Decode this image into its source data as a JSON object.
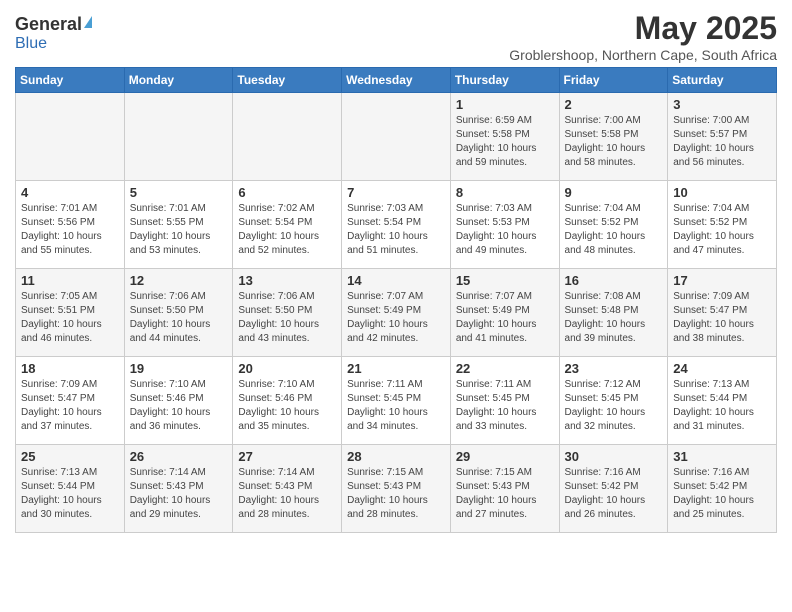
{
  "header": {
    "logo": {
      "general": "General",
      "blue": "Blue"
    },
    "title": "May 2025",
    "subtitle": "Groblershoop, Northern Cape, South Africa"
  },
  "weekdays": [
    "Sunday",
    "Monday",
    "Tuesday",
    "Wednesday",
    "Thursday",
    "Friday",
    "Saturday"
  ],
  "weeks": [
    [
      {
        "day": "",
        "info": ""
      },
      {
        "day": "",
        "info": ""
      },
      {
        "day": "",
        "info": ""
      },
      {
        "day": "",
        "info": ""
      },
      {
        "day": "1",
        "info": "Sunrise: 6:59 AM\nSunset: 5:58 PM\nDaylight: 10 hours\nand 59 minutes."
      },
      {
        "day": "2",
        "info": "Sunrise: 7:00 AM\nSunset: 5:58 PM\nDaylight: 10 hours\nand 58 minutes."
      },
      {
        "day": "3",
        "info": "Sunrise: 7:00 AM\nSunset: 5:57 PM\nDaylight: 10 hours\nand 56 minutes."
      }
    ],
    [
      {
        "day": "4",
        "info": "Sunrise: 7:01 AM\nSunset: 5:56 PM\nDaylight: 10 hours\nand 55 minutes."
      },
      {
        "day": "5",
        "info": "Sunrise: 7:01 AM\nSunset: 5:55 PM\nDaylight: 10 hours\nand 53 minutes."
      },
      {
        "day": "6",
        "info": "Sunrise: 7:02 AM\nSunset: 5:54 PM\nDaylight: 10 hours\nand 52 minutes."
      },
      {
        "day": "7",
        "info": "Sunrise: 7:03 AM\nSunset: 5:54 PM\nDaylight: 10 hours\nand 51 minutes."
      },
      {
        "day": "8",
        "info": "Sunrise: 7:03 AM\nSunset: 5:53 PM\nDaylight: 10 hours\nand 49 minutes."
      },
      {
        "day": "9",
        "info": "Sunrise: 7:04 AM\nSunset: 5:52 PM\nDaylight: 10 hours\nand 48 minutes."
      },
      {
        "day": "10",
        "info": "Sunrise: 7:04 AM\nSunset: 5:52 PM\nDaylight: 10 hours\nand 47 minutes."
      }
    ],
    [
      {
        "day": "11",
        "info": "Sunrise: 7:05 AM\nSunset: 5:51 PM\nDaylight: 10 hours\nand 46 minutes."
      },
      {
        "day": "12",
        "info": "Sunrise: 7:06 AM\nSunset: 5:50 PM\nDaylight: 10 hours\nand 44 minutes."
      },
      {
        "day": "13",
        "info": "Sunrise: 7:06 AM\nSunset: 5:50 PM\nDaylight: 10 hours\nand 43 minutes."
      },
      {
        "day": "14",
        "info": "Sunrise: 7:07 AM\nSunset: 5:49 PM\nDaylight: 10 hours\nand 42 minutes."
      },
      {
        "day": "15",
        "info": "Sunrise: 7:07 AM\nSunset: 5:49 PM\nDaylight: 10 hours\nand 41 minutes."
      },
      {
        "day": "16",
        "info": "Sunrise: 7:08 AM\nSunset: 5:48 PM\nDaylight: 10 hours\nand 39 minutes."
      },
      {
        "day": "17",
        "info": "Sunrise: 7:09 AM\nSunset: 5:47 PM\nDaylight: 10 hours\nand 38 minutes."
      }
    ],
    [
      {
        "day": "18",
        "info": "Sunrise: 7:09 AM\nSunset: 5:47 PM\nDaylight: 10 hours\nand 37 minutes."
      },
      {
        "day": "19",
        "info": "Sunrise: 7:10 AM\nSunset: 5:46 PM\nDaylight: 10 hours\nand 36 minutes."
      },
      {
        "day": "20",
        "info": "Sunrise: 7:10 AM\nSunset: 5:46 PM\nDaylight: 10 hours\nand 35 minutes."
      },
      {
        "day": "21",
        "info": "Sunrise: 7:11 AM\nSunset: 5:45 PM\nDaylight: 10 hours\nand 34 minutes."
      },
      {
        "day": "22",
        "info": "Sunrise: 7:11 AM\nSunset: 5:45 PM\nDaylight: 10 hours\nand 33 minutes."
      },
      {
        "day": "23",
        "info": "Sunrise: 7:12 AM\nSunset: 5:45 PM\nDaylight: 10 hours\nand 32 minutes."
      },
      {
        "day": "24",
        "info": "Sunrise: 7:13 AM\nSunset: 5:44 PM\nDaylight: 10 hours\nand 31 minutes."
      }
    ],
    [
      {
        "day": "25",
        "info": "Sunrise: 7:13 AM\nSunset: 5:44 PM\nDaylight: 10 hours\nand 30 minutes."
      },
      {
        "day": "26",
        "info": "Sunrise: 7:14 AM\nSunset: 5:43 PM\nDaylight: 10 hours\nand 29 minutes."
      },
      {
        "day": "27",
        "info": "Sunrise: 7:14 AM\nSunset: 5:43 PM\nDaylight: 10 hours\nand 28 minutes."
      },
      {
        "day": "28",
        "info": "Sunrise: 7:15 AM\nSunset: 5:43 PM\nDaylight: 10 hours\nand 28 minutes."
      },
      {
        "day": "29",
        "info": "Sunrise: 7:15 AM\nSunset: 5:43 PM\nDaylight: 10 hours\nand 27 minutes."
      },
      {
        "day": "30",
        "info": "Sunrise: 7:16 AM\nSunset: 5:42 PM\nDaylight: 10 hours\nand 26 minutes."
      },
      {
        "day": "31",
        "info": "Sunrise: 7:16 AM\nSunset: 5:42 PM\nDaylight: 10 hours\nand 25 minutes."
      }
    ]
  ]
}
